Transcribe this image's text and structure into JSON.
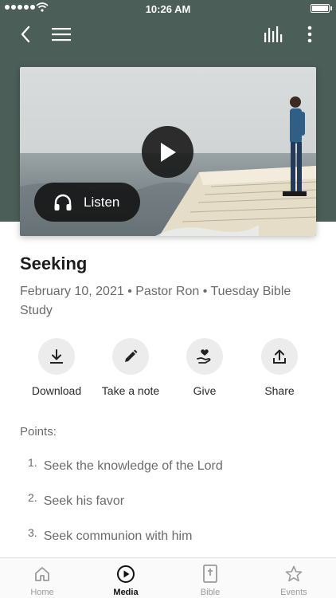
{
  "status_bar": {
    "time": "10:26 AM"
  },
  "sermon": {
    "title": "Seeking",
    "meta": "February 10, 2021 • Pastor Ron • Tuesday Bible Study",
    "listen_label": "Listen"
  },
  "actions": [
    {
      "label": "Download",
      "icon": "download-icon"
    },
    {
      "label": "Take a note",
      "icon": "pencil-icon"
    },
    {
      "label": "Give",
      "icon": "hand-heart-icon"
    },
    {
      "label": "Share",
      "icon": "share-icon"
    }
  ],
  "points": {
    "heading": "Points:",
    "items": [
      {
        "number": "1.",
        "text": "Seek the knowledge of the Lord"
      },
      {
        "number": "2.",
        "text": "Seek his favor"
      },
      {
        "number": "3.",
        "text": "Seek communion with him"
      }
    ]
  },
  "tabs": [
    {
      "label": "Home",
      "icon": "home-icon",
      "active": false
    },
    {
      "label": "Media",
      "icon": "play-circle-icon",
      "active": true
    },
    {
      "label": "Bible",
      "icon": "bible-icon",
      "active": false
    },
    {
      "label": "Events",
      "icon": "star-icon",
      "active": false
    }
  ],
  "colors": {
    "header_background": "#4b5e58",
    "action_circle": "#ececec",
    "active_tab": "#111111",
    "inactive_tab": "#9a9a9a"
  }
}
